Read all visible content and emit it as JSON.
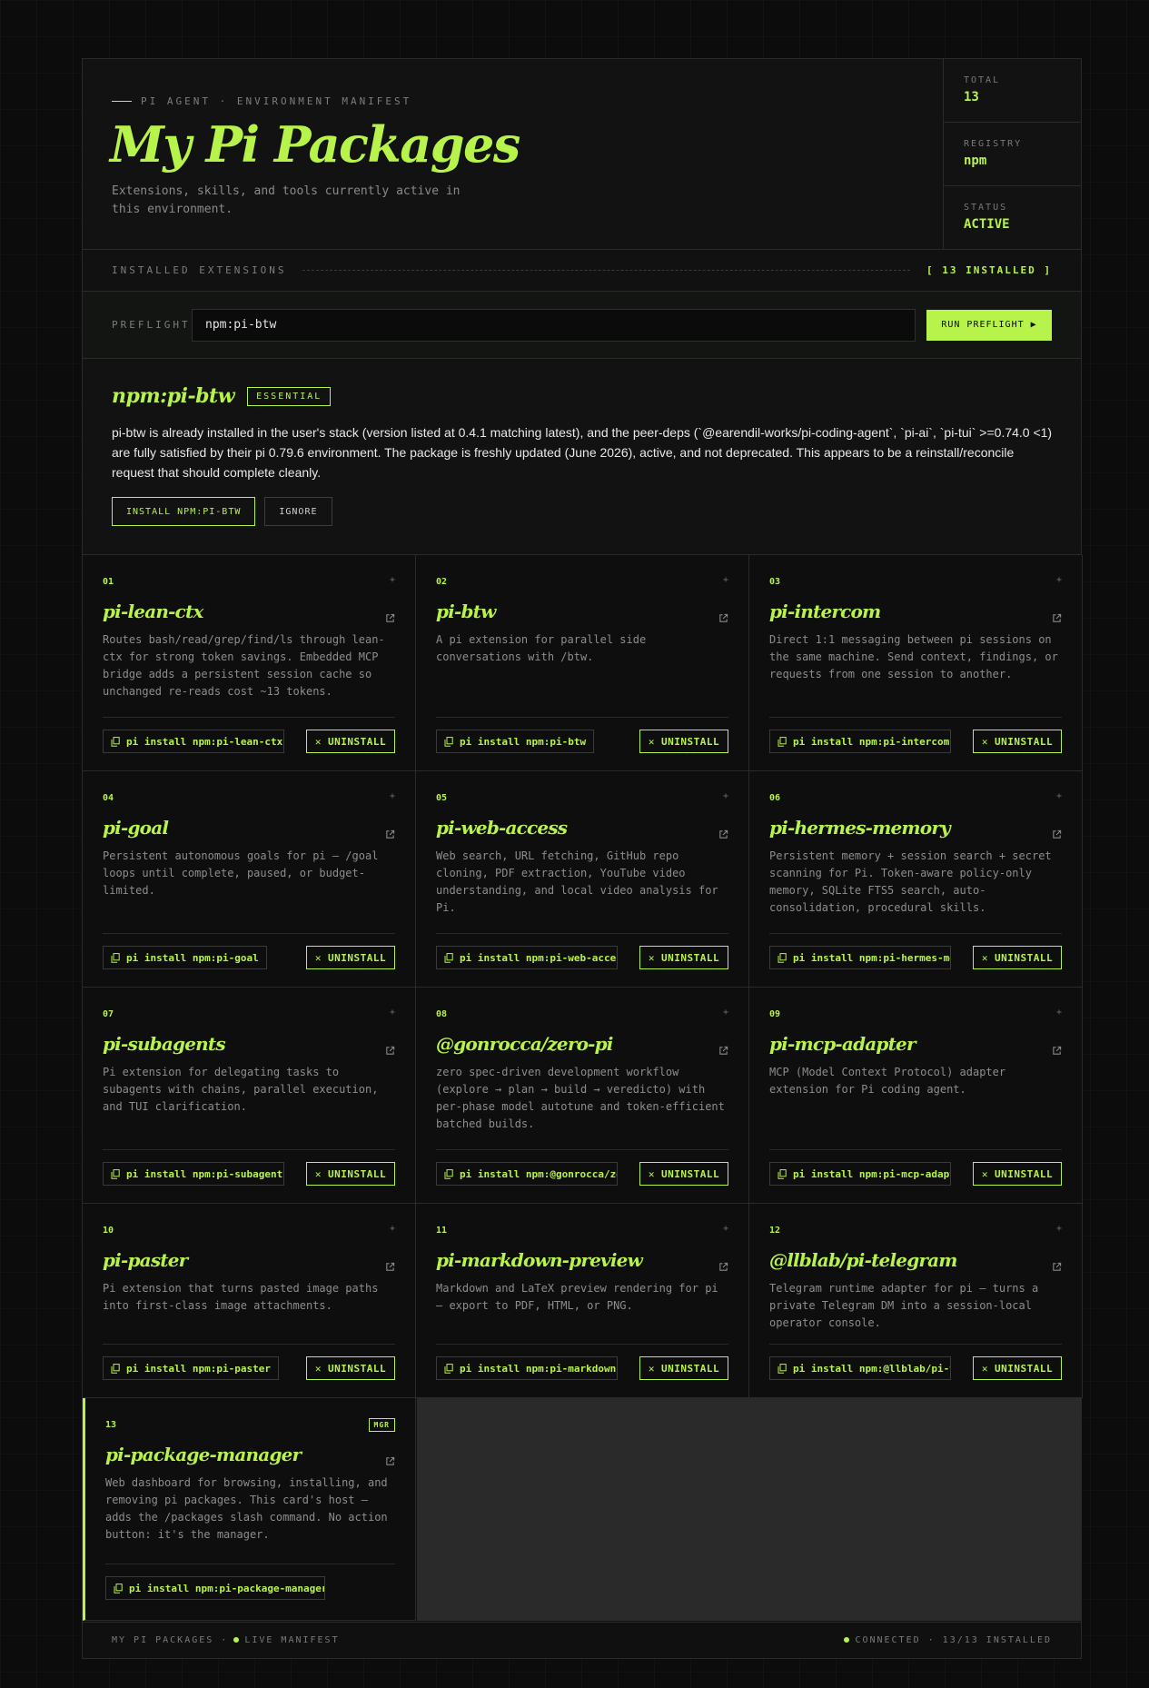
{
  "header": {
    "eyebrow": "PI AGENT · ENVIRONMENT MANIFEST",
    "title": "My Pi Packages",
    "subtitle": "Extensions, skills, and tools currently active in this environment.",
    "stats": [
      {
        "label": "TOTAL",
        "value": "13"
      },
      {
        "label": "REGISTRY",
        "value": "npm"
      },
      {
        "label": "STATUS",
        "value": "ACTIVE"
      }
    ]
  },
  "section": {
    "label": "INSTALLED EXTENSIONS",
    "count": "[ 13 INSTALLED ]"
  },
  "preflight": {
    "label": "PREFLIGHT",
    "value": "npm:pi-btw",
    "button": "RUN PREFLIGHT ▶"
  },
  "result": {
    "name": "npm:pi-btw",
    "badge": "ESSENTIAL",
    "text": "pi-btw is already installed in the user's stack (version listed at 0.4.1 matching latest), and the peer-deps (`@earendil-works/pi-coding-agent`, `pi-ai`, `pi-tui` >=0.74.0 <1) are fully satisfied by their pi 0.79.6 environment. The package is freshly updated (June 2026), active, and not deprecated. This appears to be a reinstall/reconcile request that should complete cleanly.",
    "install_label": "INSTALL NPM:PI-BTW",
    "ignore_label": "IGNORE"
  },
  "packages": [
    {
      "num": "01",
      "name": "pi-lean-ctx",
      "desc": "Routes bash/read/grep/find/ls through lean-ctx for strong token savings. Embedded MCP bridge adds a persistent session cache so unchanged re-reads cost ~13 tokens.",
      "cmd": "pi install npm:pi-lean-ctx",
      "action": "✕ UNINSTALL"
    },
    {
      "num": "02",
      "name": "pi-btw",
      "desc": "A pi extension for parallel side conversations with /btw.",
      "cmd": "pi install npm:pi-btw",
      "action": "✕ UNINSTALL"
    },
    {
      "num": "03",
      "name": "pi-intercom",
      "desc": "Direct 1:1 messaging between pi sessions on the same machine. Send context, findings, or requests from one session to another.",
      "cmd": "pi install npm:pi-intercom",
      "action": "✕ UNINSTALL"
    },
    {
      "num": "04",
      "name": "pi-goal",
      "desc": "Persistent autonomous goals for pi — /goal loops until complete, paused, or budget-limited.",
      "cmd": "pi install npm:pi-goal",
      "action": "✕ UNINSTALL"
    },
    {
      "num": "05",
      "name": "pi-web-access",
      "desc": "Web search, URL fetching, GitHub repo cloning, PDF extraction, YouTube video understanding, and local video analysis for Pi.",
      "cmd": "pi install npm:pi-web-access",
      "action": "✕ UNINSTALL"
    },
    {
      "num": "06",
      "name": "pi-hermes-memory",
      "desc": "Persistent memory + session search + secret scanning for Pi. Token-aware policy-only memory, SQLite FTS5 search, auto-consolidation, procedural skills.",
      "cmd": "pi install npm:pi-hermes-memory",
      "action": "✕ UNINSTALL"
    },
    {
      "num": "07",
      "name": "pi-subagents",
      "desc": "Pi extension for delegating tasks to subagents with chains, parallel execution, and TUI clarification.",
      "cmd": "pi install npm:pi-subagents",
      "action": "✕ UNINSTALL"
    },
    {
      "num": "08",
      "name": "@gonrocca/zero-pi",
      "desc": "zero spec-driven development workflow (explore → plan → build → veredicto) with per-phase model autotune and token-efficient batched builds.",
      "cmd": "pi install npm:@gonrocca/zero-pi",
      "action": "✕ UNINSTALL"
    },
    {
      "num": "09",
      "name": "pi-mcp-adapter",
      "desc": "MCP (Model Context Protocol) adapter extension for Pi coding agent.",
      "cmd": "pi install npm:pi-mcp-adapter",
      "action": "✕ UNINSTALL"
    },
    {
      "num": "10",
      "name": "pi-paster",
      "desc": "Pi extension that turns pasted image paths into first-class image attachments.",
      "cmd": "pi install npm:pi-paster",
      "action": "✕ UNINSTALL"
    },
    {
      "num": "11",
      "name": "pi-markdown-preview",
      "desc": "Markdown and LaTeX preview rendering for pi — export to PDF, HTML, or PNG.",
      "cmd": "pi install npm:pi-markdown-preview",
      "action": "✕ UNINSTALL"
    },
    {
      "num": "12",
      "name": "@llblab/pi-telegram",
      "desc": "Telegram runtime adapter for pi — turns a private Telegram DM into a session-local operator console.",
      "cmd": "pi install npm:@llblab/pi-telegram",
      "action": "✕ UNINSTALL"
    },
    {
      "num": "13",
      "name": "pi-package-manager",
      "badge": "MGR",
      "desc": "Web dashboard for browsing, installing, and removing pi packages. This card's host — adds the /packages slash command. No action button: it's the manager.",
      "cmd": "pi install npm:pi-package-manager"
    }
  ],
  "footer": {
    "left_a": "MY PI PACKAGES ·",
    "left_b": "LIVE MANIFEST",
    "right": "CONNECTED · 13/13 INSTALLED"
  },
  "colors": {
    "accent": "#b7f34a",
    "background": "#0c0c0c"
  }
}
